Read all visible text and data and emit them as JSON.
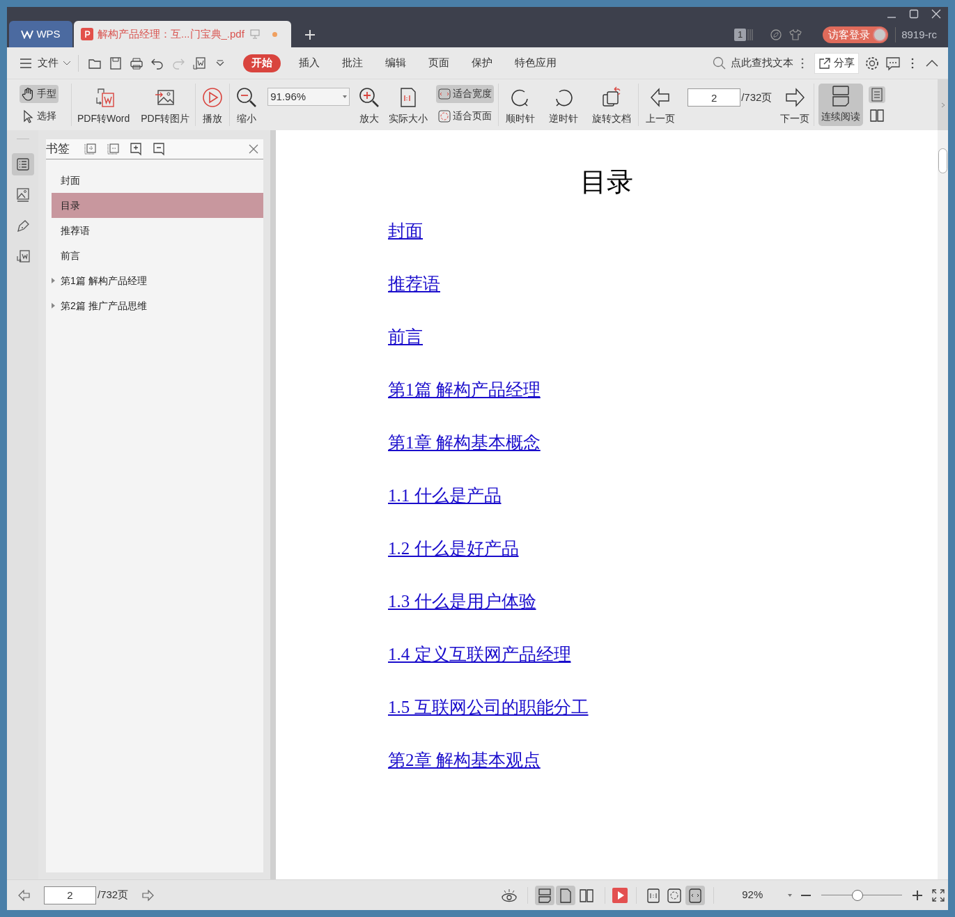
{
  "tabs": [
    {
      "label": "WPS",
      "kind": "home",
      "selected": false
    },
    {
      "label": "解构产品经理：互...门宝典_.pdf",
      "kind": "doc",
      "selected": true
    }
  ],
  "title_bar": {
    "window_badge": "1",
    "login_button": "访客登录",
    "user_name": "8919-rc"
  },
  "menu": {
    "file_label": "文件",
    "tabs": [
      {
        "label": "开始",
        "selected": true
      },
      {
        "label": "插入",
        "selected": false
      },
      {
        "label": "批注",
        "selected": false
      },
      {
        "label": "编辑",
        "selected": false
      },
      {
        "label": "页面",
        "selected": false
      },
      {
        "label": "保护",
        "selected": false
      },
      {
        "label": "特色应用",
        "selected": false
      }
    ],
    "search": {
      "placeholder": "点此查找文本"
    },
    "share_label": "分享"
  },
  "toolbar": {
    "modes": [
      {
        "label": "手型",
        "kind": "hand",
        "selected": true
      },
      {
        "label": "选择",
        "kind": "select",
        "selected": false
      }
    ],
    "convert": [
      {
        "label": "PDF转Word",
        "kind": "word"
      },
      {
        "label": "PDF转图片",
        "kind": "image"
      },
      {
        "label": "播放",
        "kind": "play"
      },
      {
        "label": "缩小",
        "kind": "zoom_out"
      }
    ],
    "zoom_value": "91.96%",
    "zoom_tools": [
      {
        "label": "放大",
        "kind": "zoom_in"
      },
      {
        "label": "实际大小",
        "kind": "actual"
      }
    ],
    "fit": [
      {
        "label": "适合宽度",
        "kind": "width",
        "selected": true
      },
      {
        "label": "适合页面",
        "kind": "page",
        "selected": false
      }
    ],
    "rotate": [
      {
        "label": "顺时针",
        "kind": "cw"
      },
      {
        "label": "逆时针",
        "kind": "ccw"
      },
      {
        "label": "旋转文档",
        "kind": "doc"
      },
      {
        "label": "上一页",
        "kind": "prev"
      }
    ],
    "page_input": "2",
    "page_total": "/732页",
    "next_label": "下一页",
    "continuous": {
      "label": "连续阅读",
      "selected": true
    }
  },
  "sidebar": {
    "title": "书签",
    "bookmarks": [
      {
        "label": "封面",
        "selected": false,
        "has_children": false
      },
      {
        "label": "目录",
        "selected": true,
        "has_children": false
      },
      {
        "label": "推荐语",
        "selected": false,
        "has_children": false
      },
      {
        "label": "前言",
        "selected": false,
        "has_children": false
      },
      {
        "label": "第1篇 解构产品经理",
        "selected": false,
        "has_children": true
      },
      {
        "label": "第2篇 推广产品思维",
        "selected": false,
        "has_children": true
      }
    ]
  },
  "document": {
    "heading": "目录",
    "links": [
      "封面",
      "推荐语",
      "前言",
      "第1篇 解构产品经理",
      "第1章 解构基本概念",
      "1.1 什么是产品",
      "1.2 什么是好产品",
      "1.3 什么是用户体验",
      "1.4 定义互联网产品经理",
      "1.5 互联网公司的职能分工",
      "第2章 解构基本观点"
    ]
  },
  "status_bar": {
    "page_input": "2",
    "page_total": "/732页",
    "views": [
      {
        "kind": "continuous",
        "selected": true
      },
      {
        "kind": "single",
        "selected": true
      },
      {
        "kind": "double",
        "selected": false
      }
    ],
    "fits": [
      {
        "kind": "actual",
        "selected": false
      },
      {
        "kind": "page",
        "selected": false
      },
      {
        "kind": "width",
        "selected": true
      }
    ],
    "zoom": "92%",
    "zoom_slider": {
      "level": 0.44
    }
  }
}
